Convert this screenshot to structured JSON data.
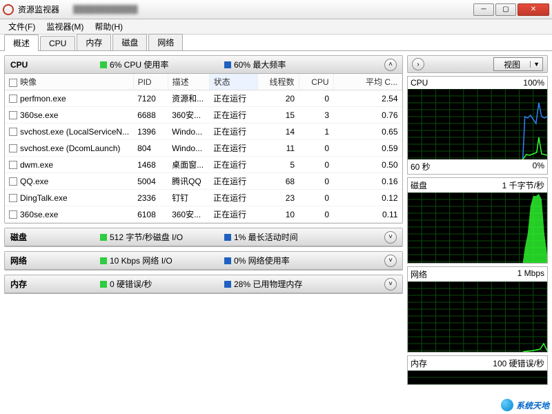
{
  "window": {
    "title": "资源监视器"
  },
  "menus": {
    "file": "文件(F)",
    "monitor": "监视器(M)",
    "help": "帮助(H)"
  },
  "tabs": {
    "overview": "概述",
    "cpu": "CPU",
    "memory": "内存",
    "disk": "磁盘",
    "network": "网络"
  },
  "cpu_section": {
    "title": "CPU",
    "stat1": "6% CPU 使用率",
    "stat2": "60% 最大频率",
    "cols": {
      "image": "映像",
      "pid": "PID",
      "desc": "描述",
      "status": "状态",
      "threads": "线程数",
      "cpu": "CPU",
      "avg": "平均 C..."
    },
    "rows": [
      {
        "image": "perfmon.exe",
        "pid": "7120",
        "desc": "资源和...",
        "status": "正在运行",
        "threads": "20",
        "cpu": "0",
        "avg": "2.54"
      },
      {
        "image": "360se.exe",
        "pid": "6688",
        "desc": "360安...",
        "status": "正在运行",
        "threads": "15",
        "cpu": "3",
        "avg": "0.76"
      },
      {
        "image": "svchost.exe (LocalServiceN...",
        "pid": "1396",
        "desc": "Windo...",
        "status": "正在运行",
        "threads": "14",
        "cpu": "1",
        "avg": "0.65"
      },
      {
        "image": "svchost.exe (DcomLaunch)",
        "pid": "804",
        "desc": "Windo...",
        "status": "正在运行",
        "threads": "11",
        "cpu": "0",
        "avg": "0.59"
      },
      {
        "image": "dwm.exe",
        "pid": "1468",
        "desc": "桌面窗...",
        "status": "正在运行",
        "threads": "5",
        "cpu": "0",
        "avg": "0.50"
      },
      {
        "image": "QQ.exe",
        "pid": "5004",
        "desc": "腾讯QQ",
        "status": "正在运行",
        "threads": "68",
        "cpu": "0",
        "avg": "0.16"
      },
      {
        "image": "DingTalk.exe",
        "pid": "2336",
        "desc": "钉钉",
        "status": "正在运行",
        "threads": "23",
        "cpu": "0",
        "avg": "0.12"
      },
      {
        "image": "360se.exe",
        "pid": "6108",
        "desc": "360安...",
        "status": "正在运行",
        "threads": "10",
        "cpu": "0",
        "avg": "0.11"
      }
    ]
  },
  "disk_section": {
    "title": "磁盘",
    "stat1": "512 字节/秒磁盘 I/O",
    "stat2": "1% 最长活动时间"
  },
  "net_section": {
    "title": "网络",
    "stat1": "10 Kbps 网络 I/O",
    "stat2": "0% 网络使用率"
  },
  "mem_section": {
    "title": "内存",
    "stat1": "0 硬错误/秒",
    "stat2": "28% 已用物理内存"
  },
  "right": {
    "view": "视图",
    "charts": {
      "cpu": {
        "title": "CPU",
        "right": "100%",
        "foot_l": "60 秒",
        "foot_r": "0%"
      },
      "disk": {
        "title": "磁盘",
        "right": "1 千字节/秒"
      },
      "net": {
        "title": "网络",
        "right": "1 Mbps"
      },
      "mem": {
        "title": "内存",
        "right": "100 硬错误/秒"
      }
    }
  },
  "watermark": "系统天地",
  "chart_data": {
    "type": "line",
    "title": "CPU usage (60s window)",
    "xlabel": "seconds ago",
    "ylabel": "%",
    "series": [
      {
        "name": "max_freq",
        "values": [
          60,
          60,
          60,
          58,
          60,
          62,
          60,
          55,
          70,
          60
        ]
      },
      {
        "name": "cpu_usage",
        "values": [
          6,
          5,
          7,
          6,
          8,
          6,
          5,
          6,
          30,
          6
        ]
      }
    ],
    "x": [
      60,
      54,
      48,
      42,
      36,
      30,
      24,
      18,
      12,
      6
    ],
    "ylim": [
      0,
      100
    ]
  }
}
